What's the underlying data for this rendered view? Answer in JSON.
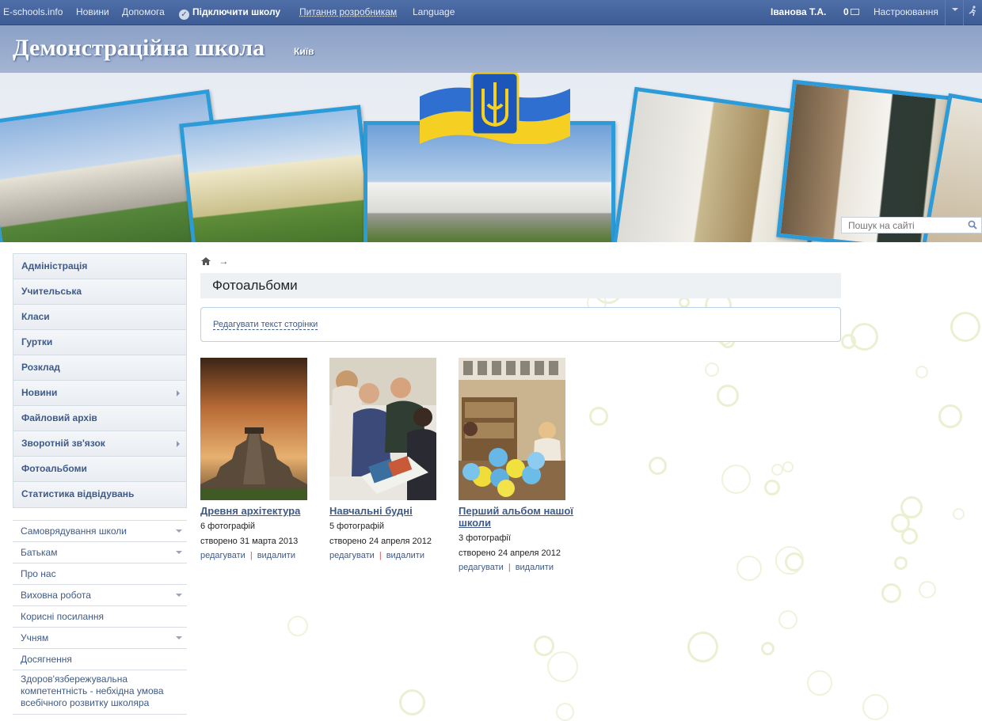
{
  "topbar": {
    "site": "E-schools.info",
    "news": "Новини",
    "help": "Допомога",
    "connect": "Підключити школу",
    "dev_questions": "Питання розробникам",
    "language": "Language",
    "user": "Іванова Т.А.",
    "messages_count": "0",
    "settings": "Настроювання"
  },
  "banner": {
    "school_name": "Демонстраційна школа",
    "city": "Київ"
  },
  "search": {
    "placeholder": "Пошук на сайті"
  },
  "nav_main": [
    {
      "label": "Адміністрація"
    },
    {
      "label": "Учительська"
    },
    {
      "label": "Класи"
    },
    {
      "label": "Гуртки"
    },
    {
      "label": "Розклад"
    },
    {
      "label": "Новини"
    },
    {
      "label": "Файловий архів"
    },
    {
      "label": "Зворотній зв'язок"
    },
    {
      "label": "Фотоальбоми"
    },
    {
      "label": "Статистика відвідувань"
    }
  ],
  "nav_secondary": [
    {
      "label": "Самоврядування школи"
    },
    {
      "label": "Батькам"
    },
    {
      "label": "Про нас"
    },
    {
      "label": "Виховна робота"
    },
    {
      "label": "Корисні посилання"
    },
    {
      "label": "Учням"
    },
    {
      "label": "Досягнення"
    },
    {
      "label": "Здоров'язбережувальна компетентність - небхідна умова всебічного розвитку школяра"
    }
  ],
  "page": {
    "title": "Фотоальбоми",
    "edit_link": "Редагувати текст сторінки"
  },
  "albums": [
    {
      "title": "Древня архітектура",
      "count": "6 фотографій",
      "created": "створено 31 марта 2013",
      "edit": "редагувати",
      "delete": "видалити"
    },
    {
      "title": "Навчальні будні",
      "count": "5 фотографій",
      "created": "створено 24 апреля 2012",
      "edit": "редагувати",
      "delete": "видалити"
    },
    {
      "title": "Перший альбом нашої школи",
      "count": "3 фотографії",
      "created": "створено 24 апреля 2012",
      "edit": "редагувати",
      "delete": "видалити"
    }
  ],
  "colors": {
    "topbar": "#3d5b94",
    "nav_text": "#3f5a86",
    "photo_frame": "#2c9bd8"
  }
}
